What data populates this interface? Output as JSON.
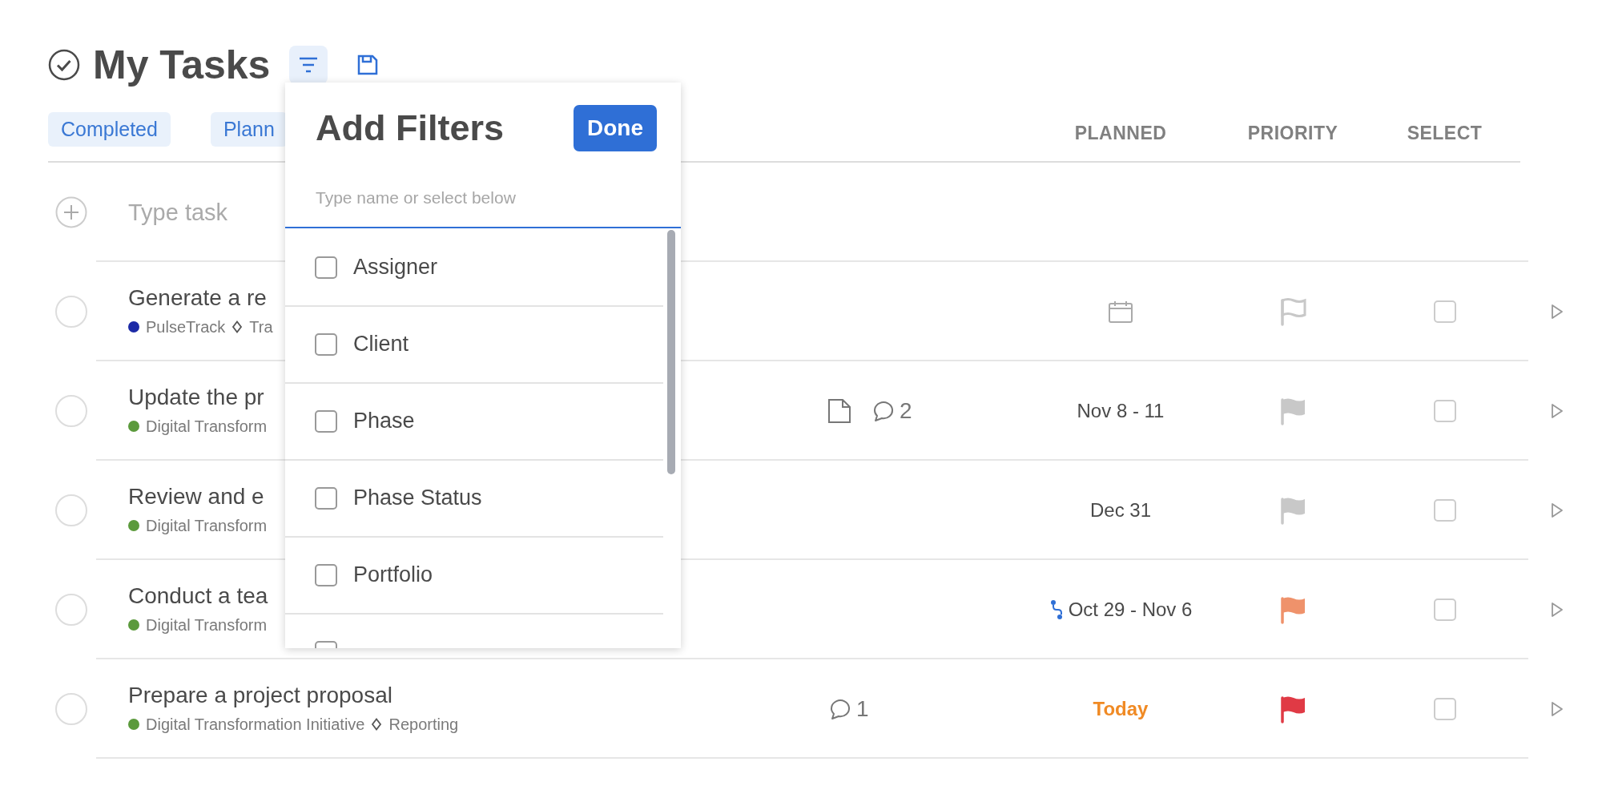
{
  "header": {
    "title": "My Tasks"
  },
  "filter_chips": [
    {
      "label": "Completed"
    },
    {
      "label": "Plann"
    }
  ],
  "columns": [
    "PLANNED",
    "PRIORITY",
    "SELECT"
  ],
  "new_task": {
    "placeholder": "Type task"
  },
  "tasks": [
    {
      "title": "Generate a re",
      "done": false,
      "project": {
        "name": "PulseTrack",
        "color": "#1c2aa6"
      },
      "section": "Tra",
      "attachment": false,
      "planned": {
        "kind": "unset"
      },
      "flag": {
        "filled": false,
        "color": "#c8c8c8"
      },
      "selected": false
    },
    {
      "title": "Update the pr",
      "done": false,
      "project": {
        "name": "Digital Transform",
        "color": "#5b9a3c"
      },
      "attachment": true,
      "comments": "2",
      "planned": {
        "kind": "date",
        "text": "Nov 8 - 11"
      },
      "flag": {
        "filled": true,
        "color": "#c8c8c8"
      },
      "selected": false
    },
    {
      "title": "Review and e",
      "done": false,
      "project": {
        "name": "Digital Transform",
        "color": "#5b9a3c"
      },
      "attachment": false,
      "planned": {
        "kind": "date",
        "text": "Dec 31"
      },
      "flag": {
        "filled": true,
        "color": "#c8c8c8"
      },
      "selected": false
    },
    {
      "title": "Conduct a tea",
      "done": false,
      "project": {
        "name": "Digital Transform",
        "color": "#5b9a3c"
      },
      "attachment": false,
      "planned": {
        "kind": "dependency",
        "text": "Oct 29 - Nov 6"
      },
      "flag": {
        "filled": true,
        "color": "#ef926b"
      },
      "selected": false
    },
    {
      "title": "Prepare a project proposal",
      "done": false,
      "project": {
        "name": "Digital Transformation Initiative",
        "color": "#5b9a3c"
      },
      "section": "Reporting",
      "attachment": false,
      "comments": "1",
      "planned": {
        "kind": "today",
        "text": "Today"
      },
      "flag": {
        "filled": true,
        "color": "#e03a45"
      },
      "selected": false
    }
  ],
  "filter_popup": {
    "title": "Add Filters",
    "done_label": "Done",
    "search": {
      "placeholder": "Type name or select below"
    },
    "options": [
      {
        "label": "Assigner",
        "checked": false
      },
      {
        "label": "Client",
        "checked": false
      },
      {
        "label": "Phase",
        "checked": false
      },
      {
        "label": "Phase Status",
        "checked": false
      },
      {
        "label": "Portfolio",
        "checked": false
      },
      {
        "checked": false
      }
    ]
  }
}
